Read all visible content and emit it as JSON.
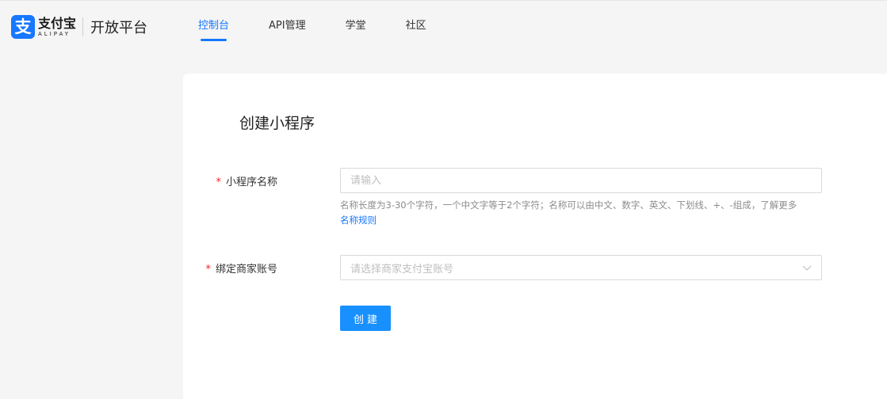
{
  "header": {
    "logo_mark": "支",
    "logo_cn": "支付宝",
    "logo_en": "ALIPAY",
    "platform": "开放平台",
    "nav": [
      {
        "label": "控制台",
        "active": true
      },
      {
        "label": "API管理",
        "active": false
      },
      {
        "label": "学堂",
        "active": false
      },
      {
        "label": "社区",
        "active": false
      }
    ]
  },
  "form": {
    "title": "创建小程序",
    "name_field": {
      "label": "小程序名称",
      "required_mark": "*",
      "placeholder": "请输入",
      "help_text": "名称长度为3-30个字符，一个中文字等于2个字符；名称可以由中文、数字、英文、下划线、+、-组成，了解更多",
      "help_link": "名称规则"
    },
    "account_field": {
      "label": "绑定商家账号",
      "required_mark": "*",
      "placeholder": "请选择商家支付宝账号"
    },
    "submit_label": "创建"
  },
  "colors": {
    "brand": "#1677ff",
    "button": "#1890ff",
    "required": "#f5222d",
    "background": "#f5f5f5"
  }
}
